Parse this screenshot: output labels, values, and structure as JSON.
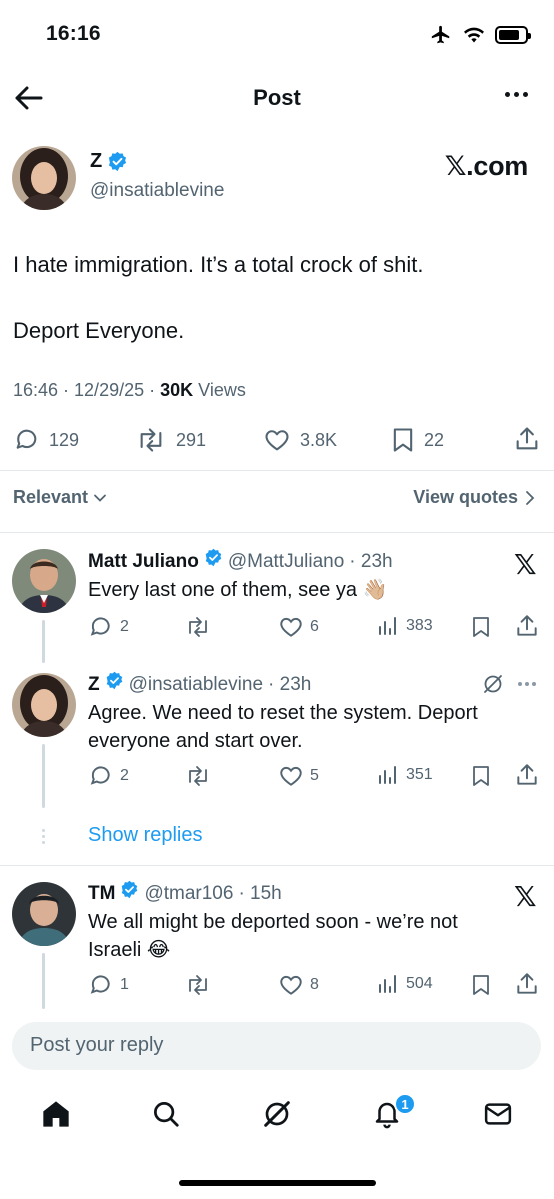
{
  "status_bar": {
    "time": "16:16"
  },
  "header": {
    "title": "Post"
  },
  "main_post": {
    "author_name": "Z",
    "handle": "@insatiablevine",
    "logo_text": "𝕏.com",
    "text": "I hate immigration.  It’s a total crock of shit.\n\nDeport Everyone.",
    "meta_time": "16:46 · 12/29/25 · ",
    "views_count": "30K",
    "views_label": " Views",
    "stats": {
      "replies": "129",
      "reposts": "291",
      "likes": "3.8K",
      "bookmarks": "22"
    }
  },
  "sort": {
    "label": "Relevant",
    "quotes_label": "View quotes"
  },
  "replies": [
    {
      "name": "Matt Juliano",
      "handle": "@MattJuliano",
      "time": "· 23h",
      "text": "Every last one of them, see ya 👋🏼",
      "replies": "2",
      "likes": "6",
      "views": "383"
    },
    {
      "name": "Z",
      "handle": "@insatiablevine",
      "time": "· 23h",
      "text": "Agree.   We need to reset the system.  Deport everyone and start over.",
      "replies": "2",
      "likes": "5",
      "views": "351"
    },
    {
      "name": "TM",
      "handle": "@tmar106",
      "time": "· 15h",
      "text": "We all might be deported soon - we’re not Israeli 😂",
      "replies": "1",
      "likes": "8",
      "views": "504"
    }
  ],
  "show_replies_label": "Show replies",
  "composer": {
    "placeholder": "Post your reply"
  },
  "tab_bar": {
    "notification_count": "1"
  },
  "colors": {
    "accent": "#1d9bf0",
    "text": "#0f1419",
    "secondary": "#536471",
    "divider": "#e6e9eb"
  }
}
